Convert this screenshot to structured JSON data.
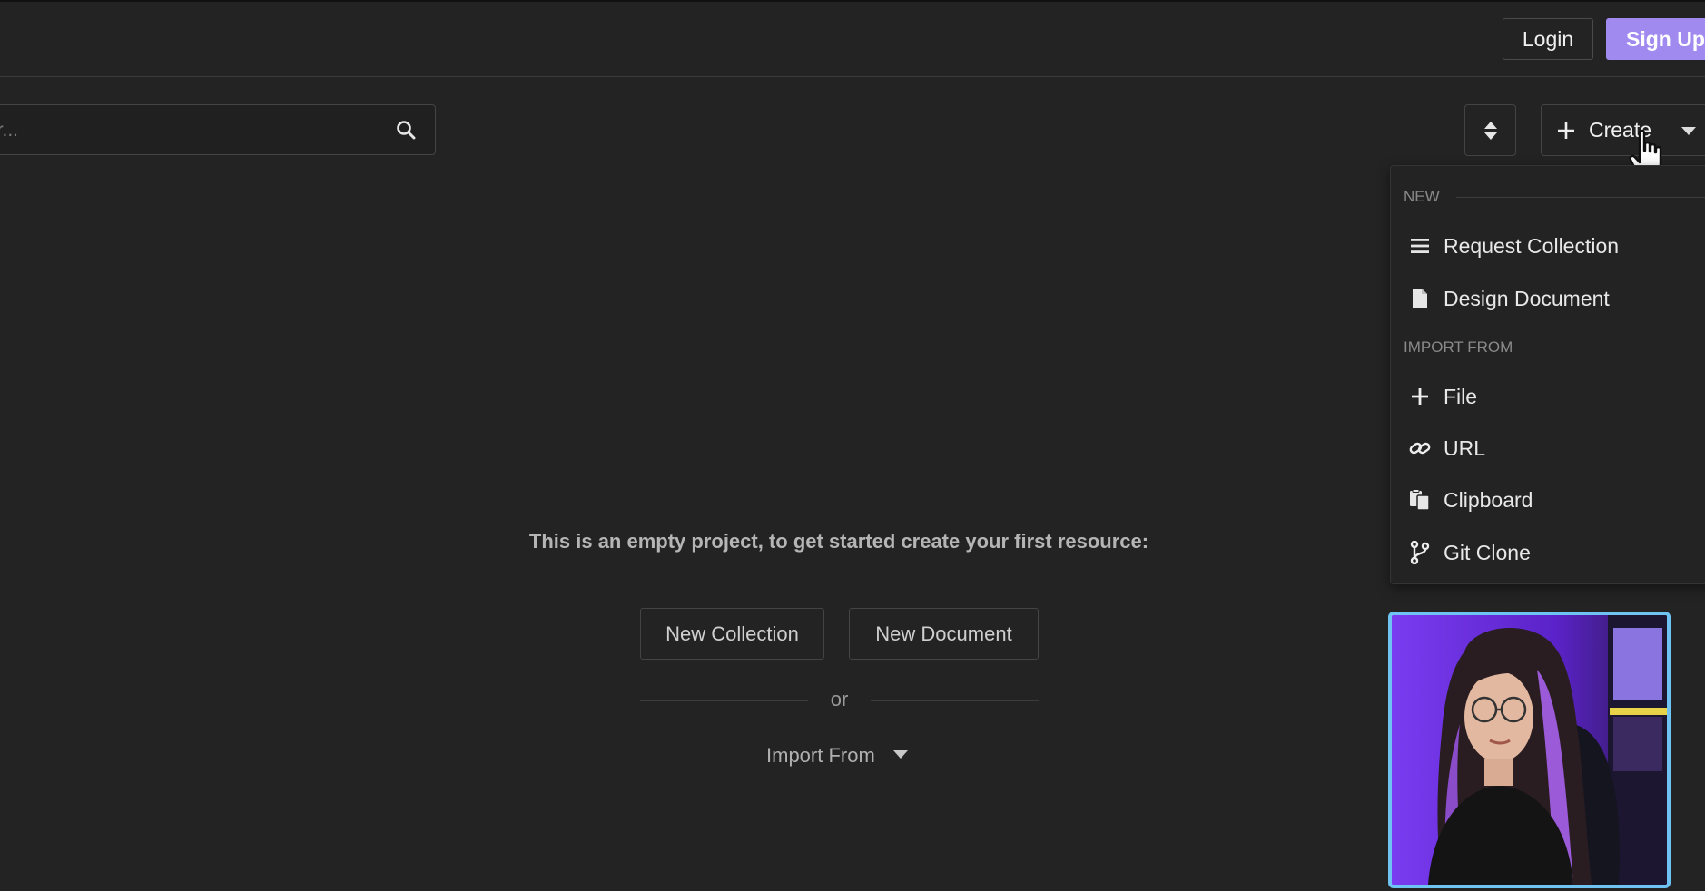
{
  "header": {
    "login_label": "Login",
    "signup_label": "Sign Up"
  },
  "filter": {
    "placeholder": "Filter..."
  },
  "toolbar": {
    "create_label": "Create"
  },
  "create_menu": {
    "new_heading": "NEW",
    "new_items": [
      {
        "label": "Request Collection",
        "icon": "list-icon"
      },
      {
        "label": "Design Document",
        "icon": "document-icon"
      }
    ],
    "import_heading": "IMPORT FROM",
    "import_items": [
      {
        "label": "File",
        "icon": "plus-icon"
      },
      {
        "label": "URL",
        "icon": "link-icon"
      },
      {
        "label": "Clipboard",
        "icon": "clipboard-icon"
      },
      {
        "label": "Git Clone",
        "icon": "git-branch-icon"
      }
    ]
  },
  "empty_state": {
    "message": "This is an empty project, to get started create your first resource:",
    "new_collection_label": "New Collection",
    "new_document_label": "New Document",
    "or_label": "or",
    "import_from_label": "Import From"
  },
  "colors": {
    "background": "#232323",
    "accent": "#a08af0",
    "webcam_border": "#6ec3f2"
  }
}
